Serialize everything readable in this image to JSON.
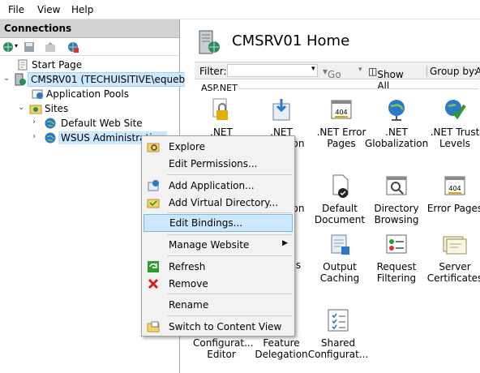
{
  "menubar": {
    "file": "File",
    "view": "View",
    "help": "Help"
  },
  "connections": {
    "title": "Connections",
    "tree": {
      "start_page": "Start Page",
      "server": "CMSRV01 (TECHUISITIVE\\equebal)",
      "app_pools": "Application Pools",
      "sites": "Sites",
      "default_site": "Default Web Site",
      "wsus": "WSUS Administration"
    }
  },
  "main": {
    "title": "CMSRV01 Home",
    "filter_label": "Filter:",
    "go_label": "Go",
    "show_all_label": "Show All",
    "group_by_label": "Group by:",
    "group_by_value": "Ar",
    "section": "ASP.NET",
    "features": {
      "net_auth": ".NET",
      "net_comp": ".NET",
      "net_comp_tail": "on",
      "net_error": ".NET Error\nPages",
      "net_glob": ".NET\nGlobalization",
      "net_trust": ".NET Trust\nLevels",
      "frag_ion": "on",
      "default_doc": "Default\nDocument",
      "dir_browse": "Directory\nBrowsing",
      "error_pages": "Error Pages",
      "frag_s": "s",
      "output_cache": "Output\nCaching",
      "req_filter": "Request\nFiltering",
      "server_certs": "Server\nCertificates",
      "config_editor": "Configurat...\nEditor",
      "feature_deleg": "Feature\nDelegation",
      "shared_config": "Shared\nConfigurat..."
    }
  },
  "context_menu": {
    "explore": "Explore",
    "edit_permissions": "Edit Permissions...",
    "add_application": "Add Application...",
    "add_vdir": "Add Virtual Directory...",
    "edit_bindings": "Edit Bindings...",
    "manage_website": "Manage Website",
    "refresh": "Refresh",
    "remove": "Remove",
    "rename": "Rename",
    "switch_content": "Switch to Content View"
  }
}
